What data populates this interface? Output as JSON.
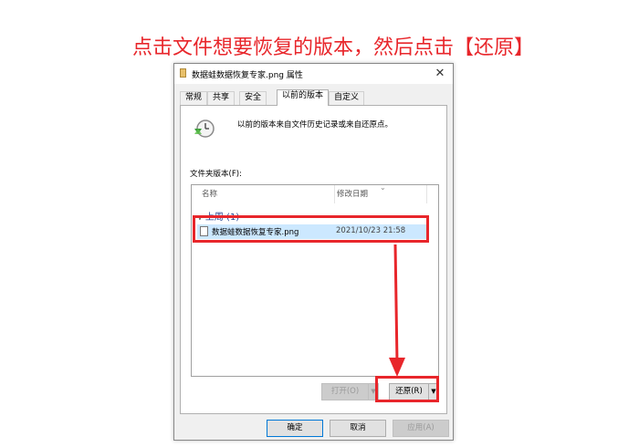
{
  "instruction": "点击文件想要恢复的版本，然后点击【还原】",
  "dialog": {
    "title": "数据蛙数据恢复专家.png 属性",
    "close_glyph": "✕",
    "tabs": [
      {
        "label": "常规",
        "active": false
      },
      {
        "label": "共享",
        "active": false
      },
      {
        "label": "安全",
        "active": false
      },
      {
        "label": "以前的版本",
        "active": true
      },
      {
        "label": "自定义",
        "active": false
      }
    ],
    "description": "以前的版本来自文件历史记录或来自还原点。",
    "folder_versions_label": "文件夹版本(F):",
    "columns": {
      "name": "名称",
      "date": "修改日期"
    },
    "group": {
      "label": "上周 (1)",
      "chevron": "∨"
    },
    "selected_file": {
      "name": "数据蛙数据恢复专家.png",
      "date": "2021/10/23 21:58"
    },
    "buttons": {
      "open": "打开(O)",
      "restore": "还原(R)",
      "split_arrow": "▼",
      "ok": "确定",
      "cancel": "取消",
      "apply": "应用(A)"
    }
  },
  "colors": {
    "highlight": "#e8262b",
    "selection": "#cce8ff",
    "accent": "#0078d7"
  }
}
